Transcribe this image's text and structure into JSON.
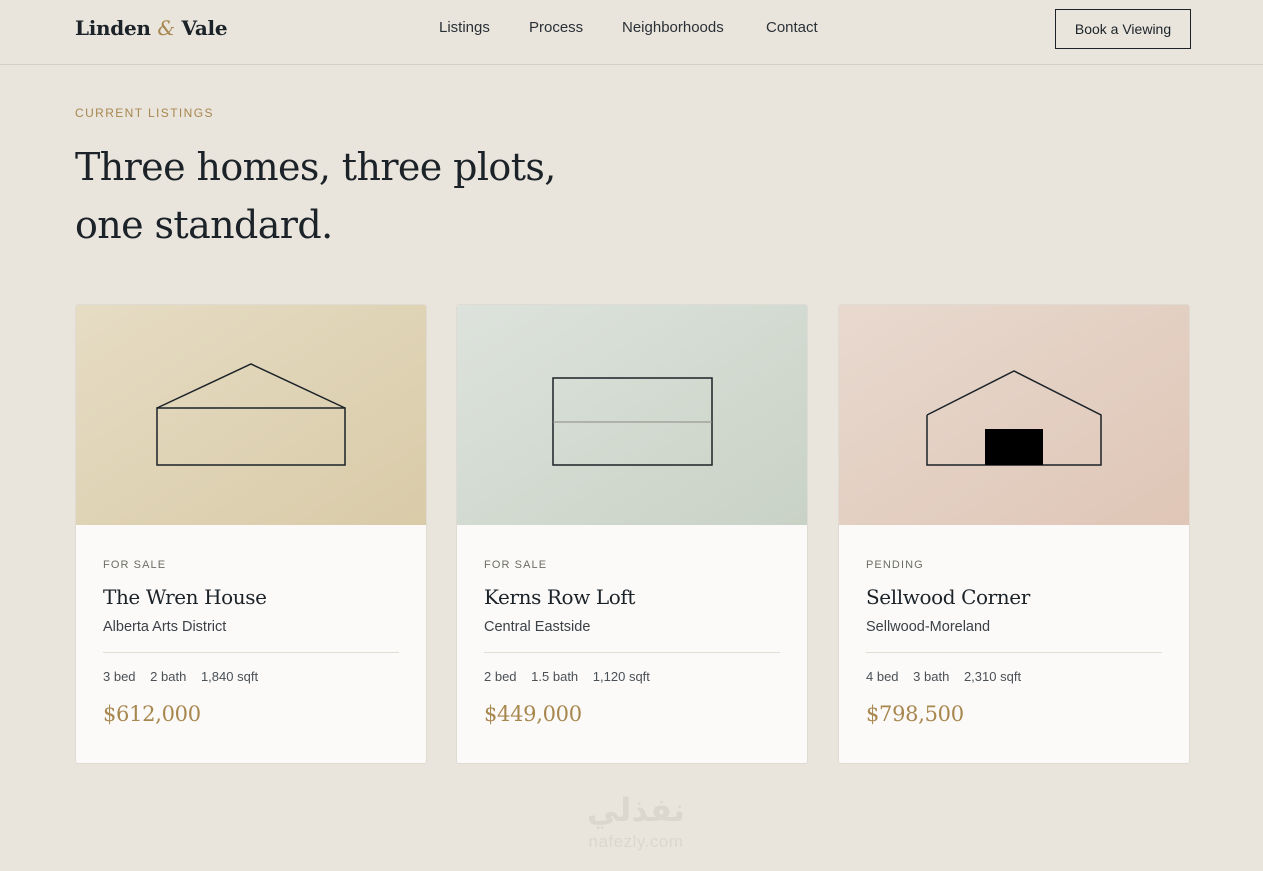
{
  "brand": {
    "name_first": "Linden",
    "ampersand": "&",
    "name_second": "Vale",
    "accent_color": "#a8874f"
  },
  "nav": {
    "items": [
      {
        "label": "Listings"
      },
      {
        "label": "Process"
      },
      {
        "label": "Neighborhoods"
      },
      {
        "label": "Contact"
      }
    ],
    "cta_label": "Book a Viewing"
  },
  "hero": {
    "eyebrow": "CURRENT LISTINGS",
    "headline": "Three homes, three plots, one standard."
  },
  "listings": [
    {
      "status": "FOR SALE",
      "title": "The Wren House",
      "location": "Alberta Arts District",
      "beds": "3 bed",
      "baths": "2 bath",
      "area": "1,840 sqft",
      "price": "$612,000",
      "image_icon": "house-outline-icon",
      "image_colors": [
        "#e6dcc4",
        "#d9cba8"
      ]
    },
    {
      "status": "FOR SALE",
      "title": "Kerns Row Loft",
      "location": "Central Eastside",
      "beds": "2 bed",
      "baths": "1.5 bath",
      "area": "1,120 sqft",
      "price": "$449,000",
      "image_icon": "loft-outline-icon",
      "image_colors": [
        "#dde3dc",
        "#c9d2c6"
      ]
    },
    {
      "status": "PENDING",
      "title": "Sellwood Corner",
      "location": "Sellwood-Moreland",
      "beds": "4 bed",
      "baths": "3 bath",
      "area": "2,310 sqft",
      "price": "$798,500",
      "image_icon": "house-with-door-icon",
      "image_colors": [
        "#e8d9cf",
        "#dfc6b6"
      ]
    }
  ],
  "watermark": {
    "arabic": "نفذلي",
    "latin": "nafezly.com"
  }
}
